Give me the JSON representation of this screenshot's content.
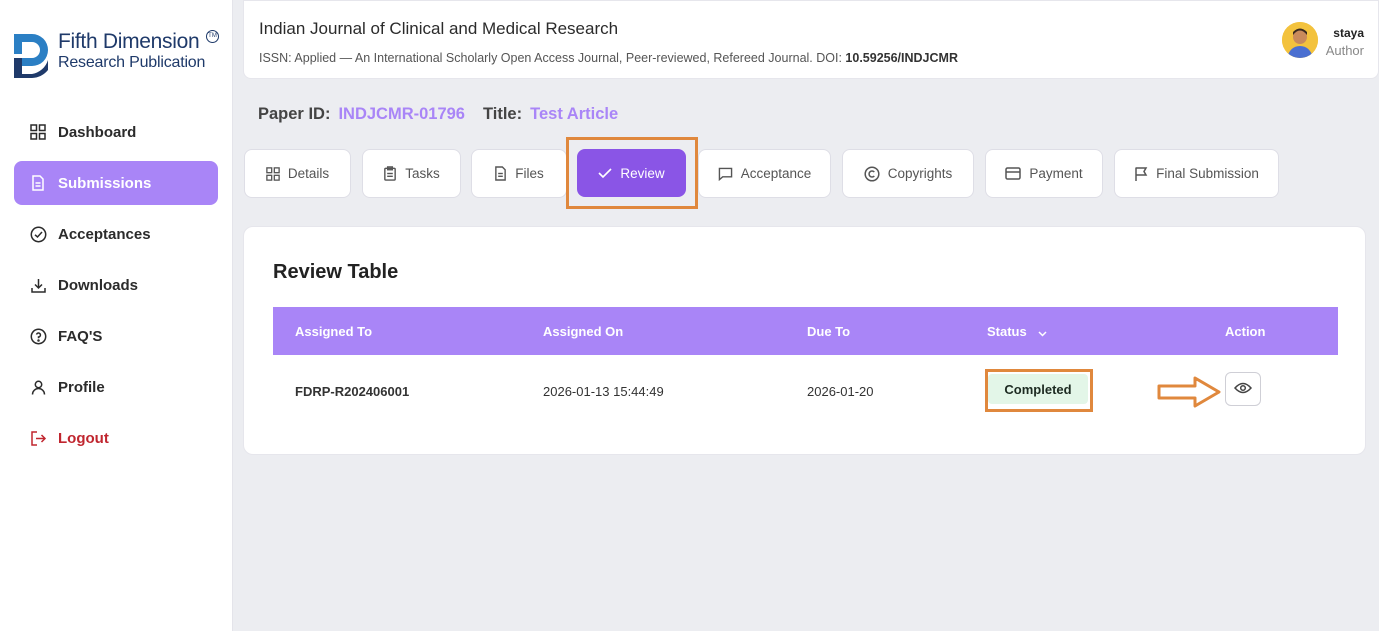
{
  "brand": {
    "line1": "Fifth Dimension",
    "line2": "Research Publication",
    "tm": "TM"
  },
  "sidebar": {
    "items": [
      {
        "label": "Dashboard",
        "icon": "grid-icon"
      },
      {
        "label": "Submissions",
        "icon": "document-icon",
        "active": true
      },
      {
        "label": "Acceptances",
        "icon": "check-circle-icon"
      },
      {
        "label": "Downloads",
        "icon": "download-icon"
      },
      {
        "label": "FAQ'S",
        "icon": "question-circle-icon"
      },
      {
        "label": "Profile",
        "icon": "user-icon"
      },
      {
        "label": "Logout",
        "icon": "logout-icon"
      }
    ]
  },
  "header": {
    "journal_title": "Indian Journal of Clinical and Medical Research",
    "journal_sub": "ISSN: Applied — An International Scholarly Open Access Journal, Peer-reviewed, Refereed Journal. DOI: ",
    "doi": "10.59256/INDJCMR",
    "user_name": "staya",
    "user_role": "Author"
  },
  "paper": {
    "id_label": "Paper ID:",
    "id_value": "INDJCMR-01796",
    "title_label": "Title:",
    "title_value": "Test Article"
  },
  "tabs": [
    {
      "label": "Details",
      "icon": "grid-icon"
    },
    {
      "label": "Tasks",
      "icon": "clipboard-icon"
    },
    {
      "label": "Files",
      "icon": "file-icon"
    },
    {
      "label": "Review",
      "icon": "check-icon",
      "active": true
    },
    {
      "label": "Acceptance",
      "icon": "message-icon"
    },
    {
      "label": "Copyrights",
      "icon": "copyright-icon"
    },
    {
      "label": "Payment",
      "icon": "credit-card-icon"
    },
    {
      "label": "Final Submission",
      "icon": "flag-icon"
    }
  ],
  "review": {
    "title": "Review Table",
    "columns": [
      "Assigned To",
      "Assigned On",
      "Due To",
      "Status",
      "Action"
    ],
    "rows": [
      {
        "assigned_to": "FDRP-R202406001",
        "assigned_on": "2026-01-13 15:44:49",
        "due_to": "2026-01-20",
        "status": "Completed",
        "action_icon": "eye-icon"
      }
    ]
  },
  "colors": {
    "accent": "#a985f7",
    "accent_dark": "#8a55e6",
    "highlight": "#e0883d",
    "logout": "#c0262f",
    "status_bg": "#e3f6e8"
  }
}
